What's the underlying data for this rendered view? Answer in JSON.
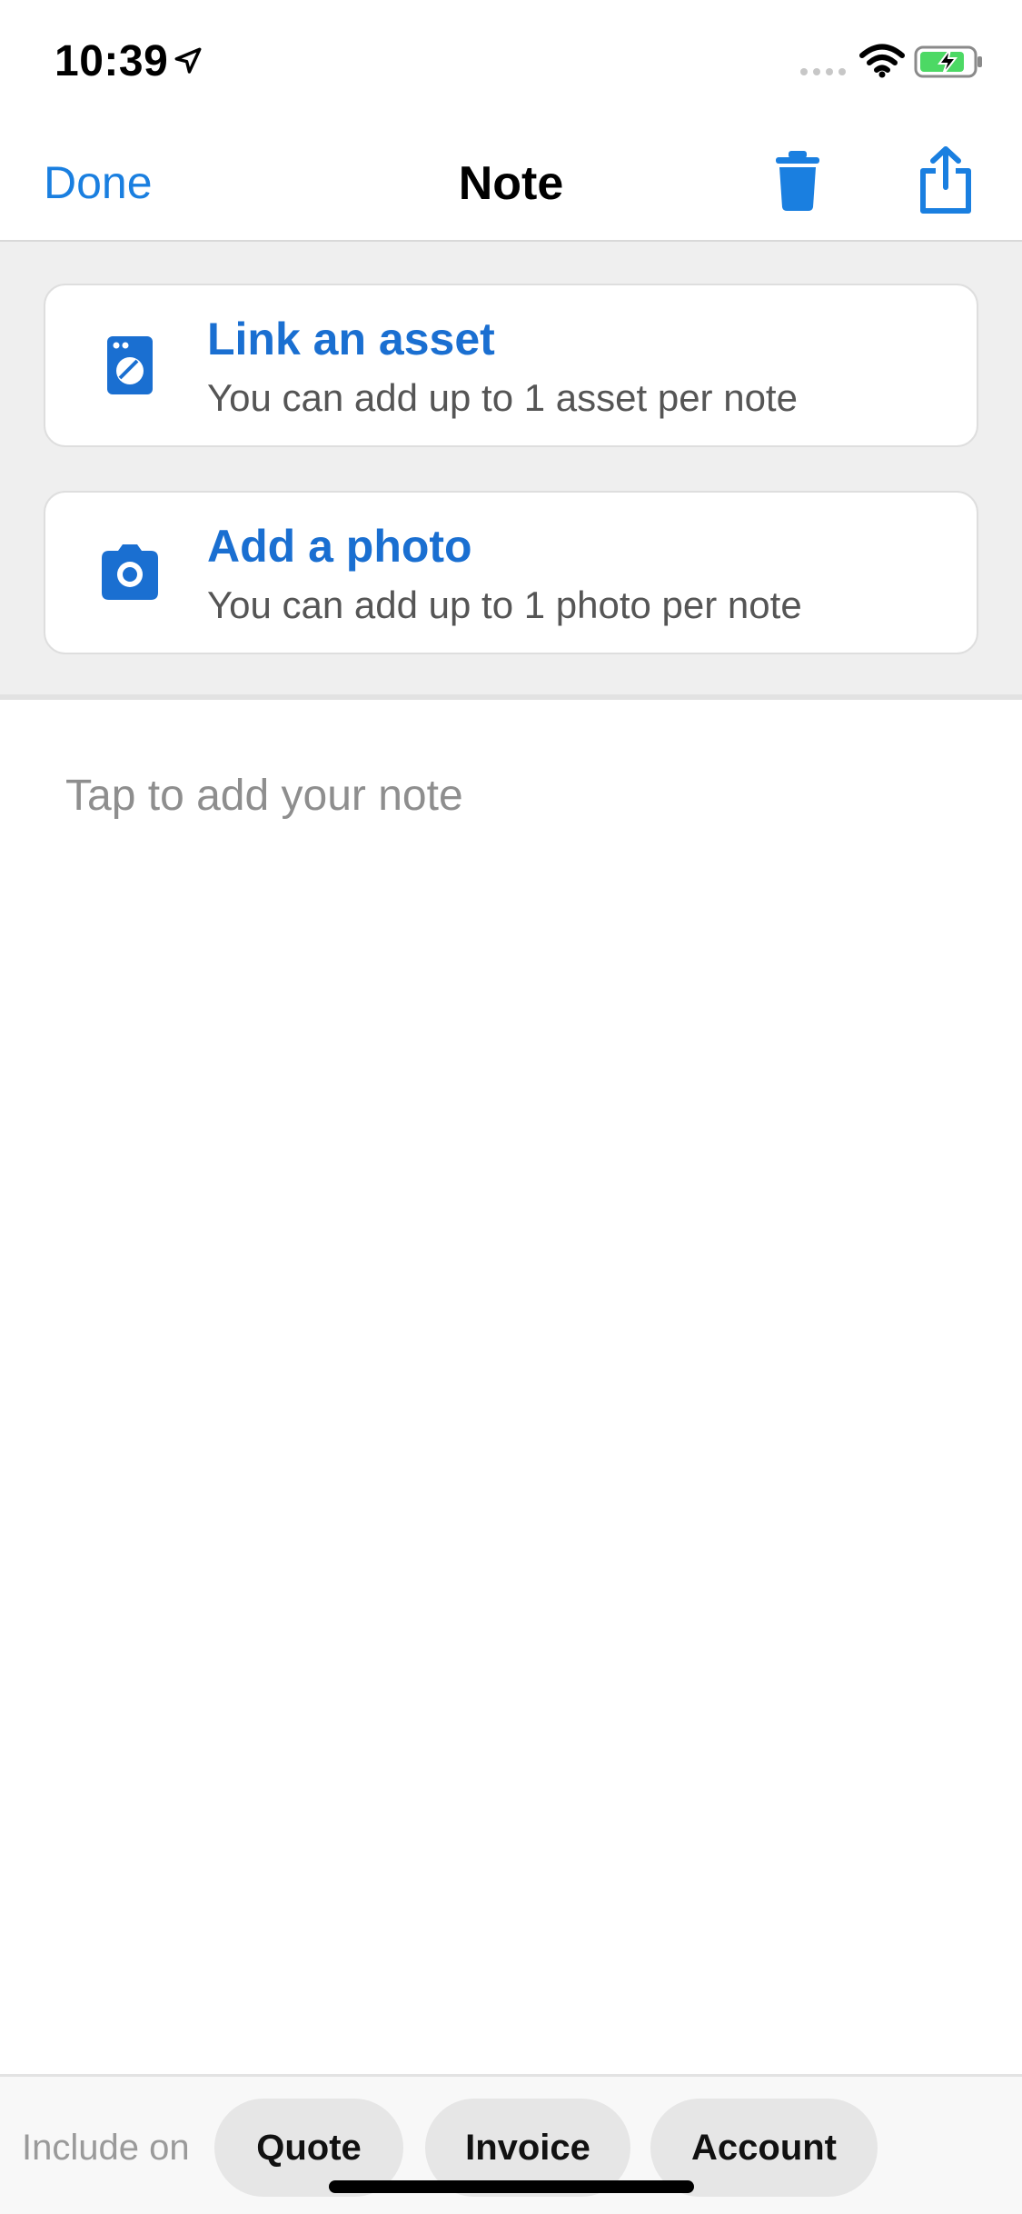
{
  "status_bar": {
    "time": "10:39",
    "icons": [
      "location-arrow-icon",
      "cellular-signal-icon",
      "wifi-icon",
      "battery-charging-icon"
    ]
  },
  "nav": {
    "done_label": "Done",
    "title": "Note",
    "actions": [
      "trash-icon",
      "share-icon"
    ]
  },
  "cards": [
    {
      "icon": "washing-machine-icon",
      "title": "Link an asset",
      "subtitle": "You can add up to 1 asset per note"
    },
    {
      "icon": "camera-icon",
      "title": "Add a photo",
      "subtitle": "You can add up to 1 photo per note"
    }
  ],
  "note": {
    "placeholder": "Tap to add your note",
    "value": ""
  },
  "bottom_bar": {
    "include_label": "Include on",
    "options": [
      "Quote",
      "Invoice",
      "Account"
    ]
  },
  "colors": {
    "accent": "#1a7fe0",
    "card_title": "#1a6fd1",
    "section_bg": "#efefef",
    "pill_bg": "#e6e6e6"
  }
}
